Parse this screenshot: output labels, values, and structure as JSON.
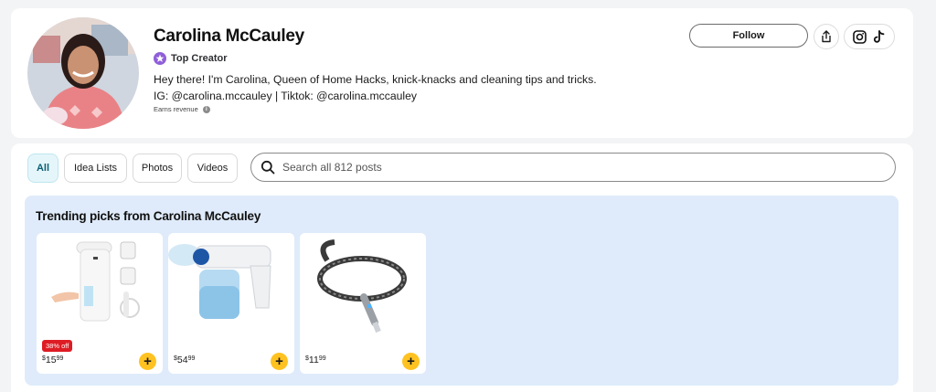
{
  "profile": {
    "name": "Carolina McCauley",
    "badge": "Top Creator",
    "bio": "Hey there! I'm Carolina, Queen of Home Hacks, knick-knacks and cleaning tips and tricks. IG: @carolina.mccauley | Tiktok: @carolina.mccauley",
    "earns_label": "Earns revenue",
    "follow_label": "Follow",
    "icons": [
      "share-icon",
      "instagram-icon",
      "tiktok-icon"
    ]
  },
  "filters": {
    "tabs": [
      "All",
      "Idea Lists",
      "Photos",
      "Videos"
    ],
    "active": "All"
  },
  "search": {
    "placeholder": "Search all 812 posts"
  },
  "trending": {
    "title": "Trending picks from Carolina McCauley",
    "products": [
      {
        "name": "Automatic soap dispenser",
        "discount": "38% off",
        "price_currency": "$",
        "price_dollars": "15",
        "price_cents": "99"
      },
      {
        "name": "Nano spray gun",
        "discount": "",
        "price_currency": "$",
        "price_dollars": "54",
        "price_cents": "99"
      },
      {
        "name": "Braided charging cable",
        "discount": "",
        "price_currency": "$",
        "price_dollars": "11",
        "price_cents": "99"
      }
    ]
  },
  "colors": {
    "accent_yellow": "#ffc220",
    "discount_red": "#de1c24",
    "trending_bg": "#dfebfa",
    "active_tab_bg": "#e5f6fa",
    "star_purple": "#8f5fd8"
  }
}
